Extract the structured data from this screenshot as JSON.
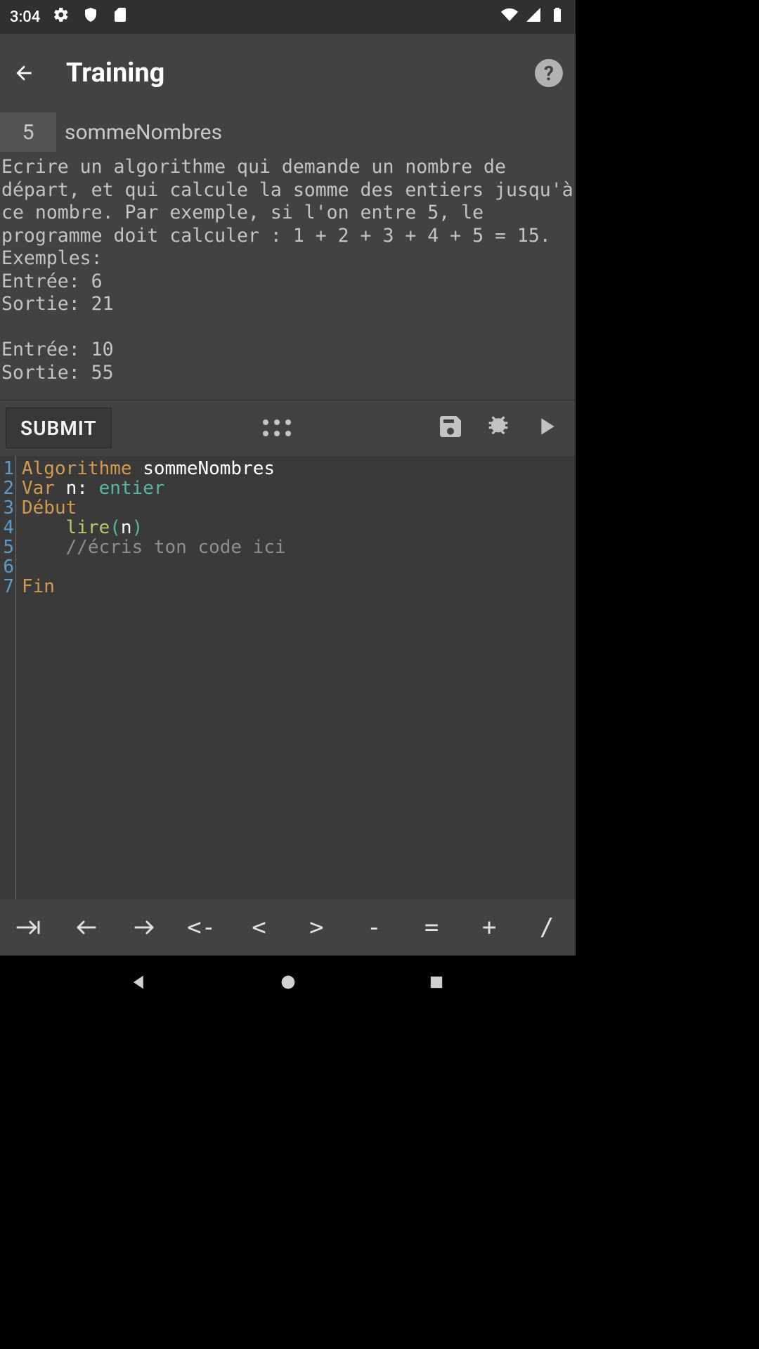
{
  "status": {
    "time": "3:04"
  },
  "header": {
    "title": "Training"
  },
  "subheader": {
    "number": "5",
    "name": "sommeNombres"
  },
  "problem": {
    "text": "Ecrire un algorithme qui demande un nombre de départ, et qui calcule la somme des entiers jusqu'à ce nombre. Par exemple, si l'on entre 5, le programme doit calculer : 1 + 2 + 3 + 4 + 5 = 15.\nExemples:\nEntrée: 6\nSortie: 21\n\nEntrée: 10\nSortie: 55"
  },
  "toolbar": {
    "submit": "SUBMIT"
  },
  "code": {
    "lines": [
      "1",
      "2",
      "3",
      "4",
      "5",
      "6",
      "7"
    ],
    "l1_kw": "Algorithme",
    "l1_id": " sommeNombres",
    "l2_kw": "Var",
    "l2_id": " n",
    "l2_colon": ":",
    "l2_type": " entier",
    "l3_kw": "Début",
    "l4_fn": "lire",
    "l4_po": "(",
    "l4_arg": "n",
    "l4_pc": ")",
    "l5_comment": "//écris ton code ici",
    "l7_kw": "Fin"
  },
  "symbols": {
    "assign": "<-",
    "lt": "<",
    "gt": ">",
    "minus": "-",
    "eq": "=",
    "plus": "+",
    "slash": "/"
  }
}
